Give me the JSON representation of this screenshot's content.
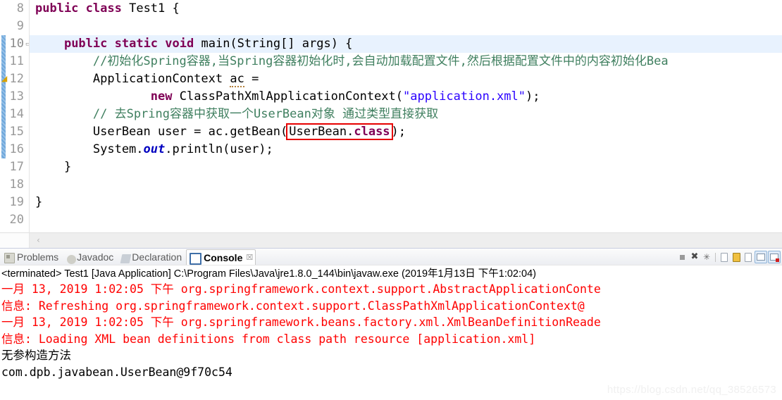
{
  "editor": {
    "lines": [
      {
        "no": "8",
        "indent": 0,
        "tokens": [
          {
            "t": "public",
            "c": "kw"
          },
          {
            "t": " ",
            "c": "plain"
          },
          {
            "t": "class",
            "c": "kw"
          },
          {
            "t": " Test1 {",
            "c": "plain"
          }
        ]
      },
      {
        "no": "9",
        "indent": 0,
        "tokens": []
      },
      {
        "no": "10",
        "indent": 0,
        "highlight": true,
        "fold": true,
        "tokens": [
          {
            "t": "    ",
            "c": "plain"
          },
          {
            "t": "public",
            "c": "kw"
          },
          {
            "t": " ",
            "c": "plain"
          },
          {
            "t": "static",
            "c": "kw"
          },
          {
            "t": " ",
            "c": "plain"
          },
          {
            "t": "void",
            "c": "kw"
          },
          {
            "t": " main(String[] args) {",
            "c": "plain"
          }
        ]
      },
      {
        "no": "11",
        "indent": 0,
        "tokens": [
          {
            "t": "        //初始化Spring容器,当Spring容器初始化时,会自动加载配置文件,然后根据配置文件中的内容初始化Bea",
            "c": "cmt"
          }
        ]
      },
      {
        "no": "12",
        "indent": 0,
        "warn": true,
        "tokens": [
          {
            "t": "        ApplicationContext ",
            "c": "plain"
          },
          {
            "t": "ac",
            "c": "undl"
          },
          {
            "t": " =",
            "c": "plain"
          }
        ]
      },
      {
        "no": "13",
        "indent": 0,
        "tokens": [
          {
            "t": "                ",
            "c": "plain"
          },
          {
            "t": "new",
            "c": "kw"
          },
          {
            "t": " ClassPathXmlApplicationContext(",
            "c": "plain"
          },
          {
            "t": "\"application.xml\"",
            "c": "str"
          },
          {
            "t": ");",
            "c": "plain"
          }
        ]
      },
      {
        "no": "14",
        "indent": 0,
        "tokens": [
          {
            "t": "        // 去Spring容器中获取一个UserBean对象 通过类型直接获取",
            "c": "cmt"
          }
        ]
      },
      {
        "no": "15",
        "indent": 0,
        "box": true,
        "tokens": [
          {
            "t": "        UserBean user = ac.getBean(",
            "c": "plain"
          },
          {
            "t": "UserBean.",
            "c": "boxstart"
          },
          {
            "t": "class",
            "c": "boxkw"
          },
          {
            "t": ");",
            "c": "plain"
          }
        ]
      },
      {
        "no": "16",
        "indent": 0,
        "tokens": [
          {
            "t": "        System.",
            "c": "plain"
          },
          {
            "t": "out",
            "c": "kw-blue"
          },
          {
            "t": ".println(user);",
            "c": "plain"
          }
        ]
      },
      {
        "no": "17",
        "indent": 0,
        "tokens": [
          {
            "t": "    }",
            "c": "plain"
          }
        ]
      },
      {
        "no": "18",
        "indent": 0,
        "tokens": []
      },
      {
        "no": "19",
        "indent": 0,
        "tokens": [
          {
            "t": "}",
            "c": "plain"
          }
        ]
      },
      {
        "no": "20",
        "indent": 0,
        "tokens": []
      }
    ],
    "scroll_left_arrow": "‹"
  },
  "tabbar": {
    "tabs": [
      {
        "label": "Problems",
        "icon": "problems-icon",
        "active": false,
        "closable": false
      },
      {
        "label": "Javadoc",
        "icon": "javadoc-icon",
        "active": false,
        "closable": false
      },
      {
        "label": "Declaration",
        "icon": "declaration-icon",
        "active": false,
        "closable": false
      },
      {
        "label": "Console",
        "icon": "console-icon",
        "active": true,
        "closable": true,
        "close_glyph": "☒"
      }
    ],
    "toolbar": [
      {
        "name": "terminate-button",
        "kind": "stop"
      },
      {
        "name": "remove-launch-button",
        "kind": "x"
      },
      {
        "name": "remove-all-launches-button",
        "kind": "xx"
      },
      {
        "name": "separator",
        "kind": "sep"
      },
      {
        "name": "clear-console-button",
        "kind": "page"
      },
      {
        "name": "scroll-lock-button",
        "kind": "lock"
      },
      {
        "name": "pin-console-button",
        "kind": "page"
      },
      {
        "name": "display-selected-console-button",
        "kind": "disp"
      },
      {
        "name": "open-console-button",
        "kind": "disp-red"
      }
    ]
  },
  "console": {
    "header": "<terminated> Test1 [Java Application] C:\\Program Files\\Java\\jre1.8.0_144\\bin\\javaw.exe (2019年1月13日 下午1:02:04)",
    "lines": [
      {
        "text": "一月 13, 2019 1:02:05 下午 org.springframework.context.support.AbstractApplicationConte",
        "stream": "err"
      },
      {
        "text": "信息: Refreshing org.springframework.context.support.ClassPathXmlApplicationContext@",
        "stream": "err"
      },
      {
        "text": "一月 13, 2019 1:02:05 下午 org.springframework.beans.factory.xml.XmlBeanDefinitionReade",
        "stream": "err"
      },
      {
        "text": "信息: Loading XML bean definitions from class path resource [application.xml]",
        "stream": "err"
      },
      {
        "text": "无参构造方法",
        "stream": "out"
      },
      {
        "text": "com.dpb.javabean.UserBean@9f70c54",
        "stream": "out"
      }
    ]
  },
  "watermark": "https://blog.csdn.net/qq_38526573",
  "colors": {
    "keyword": "#7f0055",
    "comment": "#3f7f5f",
    "string": "#2a00ff",
    "field": "#0000c0",
    "error_text": "#ff0000",
    "highlight_line": "#e8f2fe",
    "change_bar": "#6fa8dc",
    "red_box": "#e60000"
  }
}
